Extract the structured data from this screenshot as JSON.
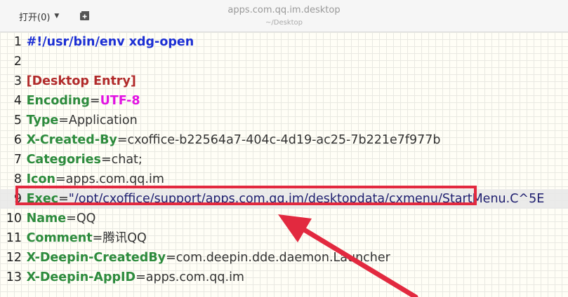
{
  "toolbar": {
    "open_label": "打开(0)",
    "open_icon": "chevron-down-icon",
    "new_tab_icon": "new-tab-icon"
  },
  "window": {
    "title": "apps.com.qq.im.desktop",
    "subtitle": "~/Desktop"
  },
  "colors": {
    "highlight_border": "#e2293f",
    "key": "#2d8b3d",
    "section": "#b12a2a",
    "shebang": "#1c2fd4",
    "encoding_value": "#e214e2"
  },
  "lines": [
    {
      "num": "1",
      "text": "#!/usr/bin/env xdg-open"
    },
    {
      "num": "2",
      "text": ""
    },
    {
      "num": "3",
      "text": "[Desktop Entry]"
    },
    {
      "num": "4",
      "key": "Encoding",
      "eq": "=",
      "value": "UTF-8"
    },
    {
      "num": "5",
      "key": "Type",
      "eq": "=",
      "value": "Application"
    },
    {
      "num": "6",
      "key": "X-Created-By",
      "eq": "=",
      "value": "cxoffice-b22564a7-404c-4d19-ac25-7b221e7f977b"
    },
    {
      "num": "7",
      "key": "Categories",
      "eq": "=",
      "value": "chat;"
    },
    {
      "num": "8",
      "key": "Icon",
      "eq": "=",
      "value": "apps.com.qq.im"
    },
    {
      "num": "9",
      "key": "Exec",
      "eq": "=",
      "value": "\"/opt/cxoffice/support/apps.com.qq.im/desktopdata/cxmenu/StartMenu.C^5E"
    },
    {
      "num": "10",
      "key": "Name",
      "eq": "=",
      "value": "QQ"
    },
    {
      "num": "11",
      "key": "Comment",
      "eq": "=",
      "value": "腾讯QQ"
    },
    {
      "num": "12",
      "key": "X-Deepin-CreatedBy",
      "eq": "=",
      "value": "com.deepin.dde.daemon.Launcher"
    },
    {
      "num": "13",
      "key": "X-Deepin-AppID",
      "eq": "=",
      "value": "apps.com.qq.im"
    }
  ]
}
